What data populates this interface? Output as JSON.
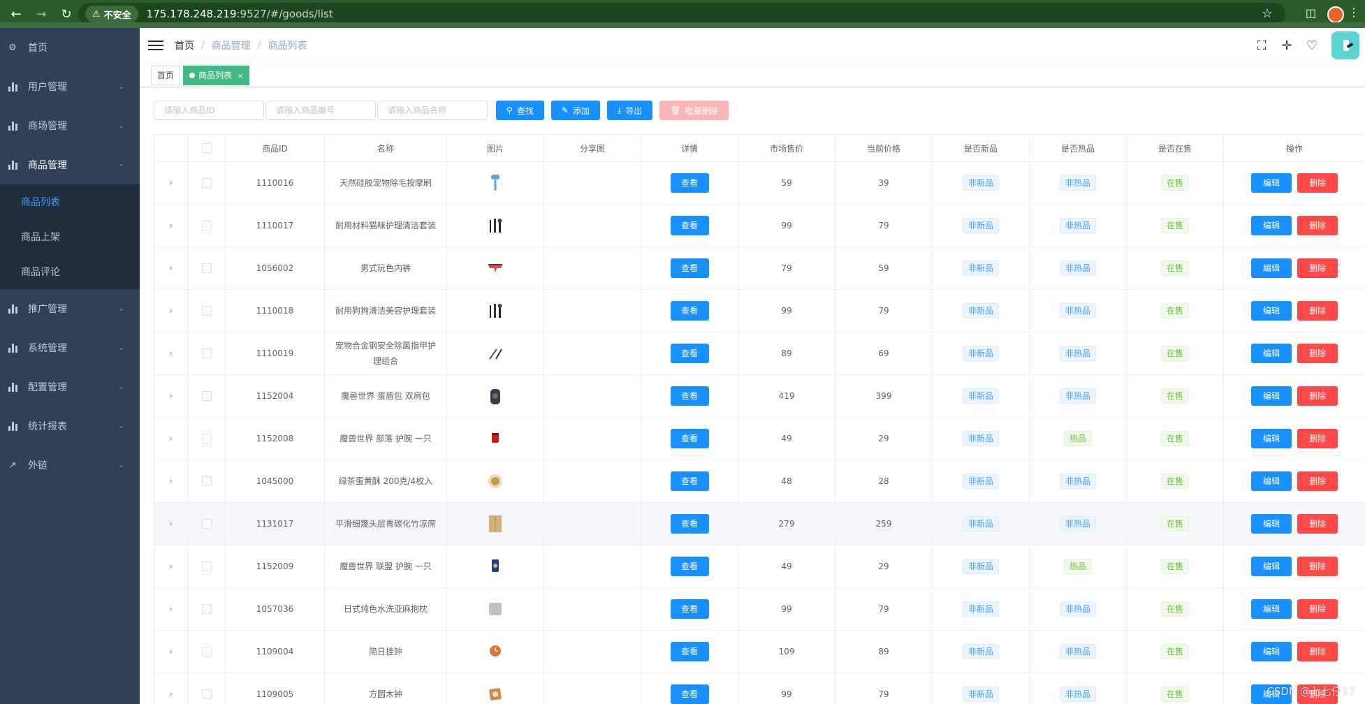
{
  "browser": {
    "insecure_label": "不安全",
    "url_host": "175.178.248.219",
    "url_rest": ":9527/#/goods/list"
  },
  "sidebar": {
    "items": [
      {
        "label": "首页",
        "icon": "dashboard-icon"
      },
      {
        "label": "用户管理",
        "icon": "chart-icon"
      },
      {
        "label": "商场管理",
        "icon": "chart-icon"
      },
      {
        "label": "商品管理",
        "icon": "chart-icon"
      },
      {
        "label": "推广管理",
        "icon": "chart-icon"
      },
      {
        "label": "系统管理",
        "icon": "chart-icon"
      },
      {
        "label": "配置管理",
        "icon": "chart-icon"
      },
      {
        "label": "统计报表",
        "icon": "chart-icon"
      },
      {
        "label": "外链",
        "icon": "external-link-icon"
      }
    ],
    "goods_sub": [
      "商品列表",
      "商品上架",
      "商品评论"
    ]
  },
  "breadcrumb": [
    "首页",
    "商品管理",
    "商品列表"
  ],
  "tags": {
    "home": "首页",
    "active": "商品列表"
  },
  "filters": {
    "id_placeholder": "请输入商品ID",
    "sn_placeholder": "请输入商品编号",
    "name_placeholder": "请输入商品名称",
    "search": "查找",
    "add": "添加",
    "export": "导出",
    "batch_delete": "批量删除"
  },
  "table": {
    "headers": [
      "商品ID",
      "名称",
      "图片",
      "分享图",
      "详情",
      "市场售价",
      "当前价格",
      "是否新品",
      "是否热品",
      "是否在售",
      "操作"
    ],
    "view_label": "查看",
    "edit_label": "编辑",
    "delete_label": "删除",
    "rows": [
      {
        "id": "1110016",
        "name": "天然硅胶宠物除毛按摩刷",
        "market": "59",
        "price": "39",
        "is_new": "非新品",
        "is_hot": "非热品",
        "on_sale": "在售",
        "img": "brush"
      },
      {
        "id": "1110017",
        "name": "耐用材料猫咪护理清洁套装",
        "market": "99",
        "price": "79",
        "is_new": "非新品",
        "is_hot": "非热品",
        "on_sale": "在售",
        "img": "tools"
      },
      {
        "id": "1056002",
        "name": "男式玩色内裤",
        "market": "79",
        "price": "59",
        "is_new": "非新品",
        "is_hot": "非热品",
        "on_sale": "在售",
        "img": "underwear"
      },
      {
        "id": "1110018",
        "name": "耐用狗狗清洁美容护理套装",
        "market": "99",
        "price": "79",
        "is_new": "非新品",
        "is_hot": "非热品",
        "on_sale": "在售",
        "img": "tools"
      },
      {
        "id": "1110019",
        "name": "宠物合金钢安全除菌指甲护理组合",
        "market": "89",
        "price": "69",
        "is_new": "非新品",
        "is_hot": "非热品",
        "on_sale": "在售",
        "img": "clippers"
      },
      {
        "id": "1152004",
        "name": "魔兽世界 蛋盾包 双肩包",
        "market": "419",
        "price": "399",
        "is_new": "非新品",
        "is_hot": "非热品",
        "on_sale": "在售",
        "img": "backpack"
      },
      {
        "id": "1152008",
        "name": "魔兽世界 部落 护腕 一只",
        "market": "49",
        "price": "29",
        "is_new": "非新品",
        "is_hot": "热品",
        "on_sale": "在售",
        "img": "wrist-red"
      },
      {
        "id": "1045000",
        "name": "绿茶蛋黄酥 200克/4枚入",
        "market": "48",
        "price": "28",
        "is_new": "非新品",
        "is_hot": "非热品",
        "on_sale": "在售",
        "img": "pastry"
      },
      {
        "id": "1131017",
        "name": "平滑细篾头层青碳化竹凉席",
        "market": "279",
        "price": "259",
        "is_new": "非新品",
        "is_hot": "非热品",
        "on_sale": "在售",
        "img": "mat"
      },
      {
        "id": "1152009",
        "name": "魔兽世界 联盟 护腕 一只",
        "market": "49",
        "price": "29",
        "is_new": "非新品",
        "is_hot": "热品",
        "on_sale": "在售",
        "img": "wrist-blue"
      },
      {
        "id": "1057036",
        "name": "日式纯色水洗亚麻抱枕",
        "market": "99",
        "price": "79",
        "is_new": "非新品",
        "is_hot": "非热品",
        "on_sale": "在售",
        "img": "pillow"
      },
      {
        "id": "1109004",
        "name": "简日挂钟",
        "market": "109",
        "price": "89",
        "is_new": "非新品",
        "is_hot": "非热品",
        "on_sale": "在售",
        "img": "clock"
      },
      {
        "id": "1109005",
        "name": "方圆木钟",
        "market": "99",
        "price": "79",
        "is_new": "非新品",
        "is_hot": "非热品",
        "on_sale": "在售",
        "img": "woodclock"
      }
    ]
  },
  "watermark": "CSDN @七七仔17"
}
